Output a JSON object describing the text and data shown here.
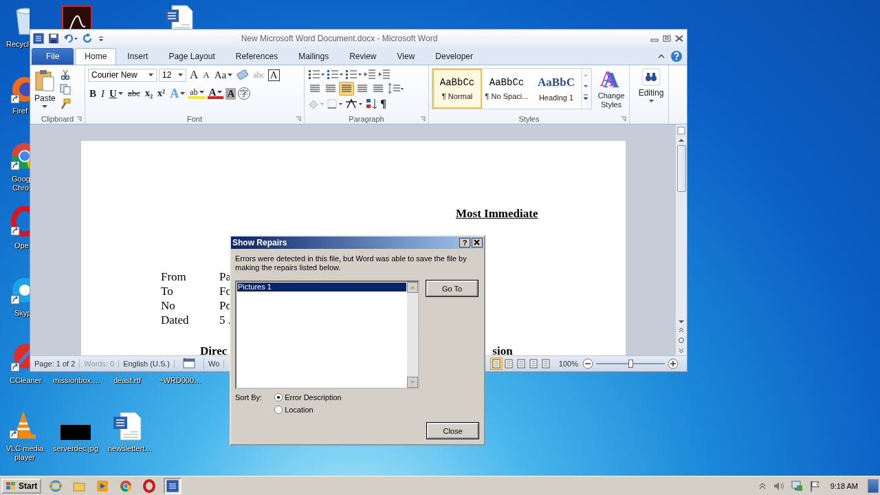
{
  "desktop": {
    "icons": [
      {
        "label": "Recycl",
        "kind": "recycle",
        "shortcut": false
      },
      {
        "kind": "pdf",
        "shortcut": false
      },
      {
        "kind": "doc",
        "shortcut": false
      },
      {
        "label": "Firef",
        "kind": "firefox",
        "shortcut": true
      },
      {
        "label": "Goog Chro",
        "kind": "chrome",
        "shortcut": true
      },
      {
        "label": "Ope",
        "kind": "opera",
        "shortcut": true
      },
      {
        "label": "Skyp",
        "kind": "skype",
        "shortcut": true
      },
      {
        "label": "CCleaner",
        "kind": "ccleaner",
        "shortcut": true
      },
      {
        "label": "missionbox.…",
        "kind": "hidden"
      },
      {
        "label": "deast.rtf",
        "kind": "hidden"
      },
      {
        "label": "~WRD000…",
        "kind": "hidden"
      },
      {
        "label": "VLC media player",
        "kind": "vlc",
        "shortcut": true
      },
      {
        "label": "serverdec.jpg",
        "kind": "image",
        "shortcut": false
      },
      {
        "label": "newslettert…",
        "kind": "doc",
        "shortcut": false
      }
    ]
  },
  "word": {
    "title": "New Microsoft Word Document.docx - Microsoft Word",
    "tabs": [
      {
        "label": "File",
        "selected": false,
        "kind": "file"
      },
      {
        "label": "Home",
        "selected": true,
        "kind": "tab"
      },
      {
        "label": "Insert",
        "selected": false,
        "kind": "tab"
      },
      {
        "label": "Page Layout",
        "selected": false,
        "kind": "tab"
      },
      {
        "label": "References",
        "selected": false,
        "kind": "tab"
      },
      {
        "label": "Mailings",
        "selected": false,
        "kind": "tab"
      },
      {
        "label": "Review",
        "selected": false,
        "kind": "tab"
      },
      {
        "label": "View",
        "selected": false,
        "kind": "tab"
      },
      {
        "label": "Developer",
        "selected": false,
        "kind": "tab"
      }
    ],
    "clipboard": {
      "paste": "Paste",
      "group": "Clipboard"
    },
    "font": {
      "face": "Courier New",
      "size": "12",
      "group": "Font",
      "row1": [
        {
          "kind": "grow",
          "text": "A"
        },
        {
          "kind": "shrink",
          "text": "A"
        },
        {
          "kind": "case",
          "text": "Aa"
        },
        {
          "kind": "clear"
        },
        {
          "kind": "phonetic",
          "text": "abc"
        },
        {
          "kind": "border",
          "text": "A"
        }
      ],
      "row2": [
        {
          "kind": "bold",
          "text": "B"
        },
        {
          "kind": "italic",
          "text": "I"
        },
        {
          "kind": "underline",
          "text": "U"
        },
        {
          "kind": "strike",
          "text": "abc"
        },
        {
          "kind": "sub",
          "text": "x₂"
        },
        {
          "kind": "sup",
          "text": "x²"
        },
        {
          "kind": "effects",
          "text": "A"
        },
        {
          "kind": "highlight",
          "text": "ab"
        },
        {
          "kind": "color",
          "text": "A"
        },
        {
          "kind": "shading",
          "text": "A"
        },
        {
          "kind": "enclose",
          "text": "字"
        }
      ]
    },
    "paragraph": {
      "group": "Paragraph",
      "pilcrow": "¶",
      "alignment": [
        {
          "selected": false
        },
        {
          "selected": false
        },
        {
          "selected": true
        },
        {
          "selected": false
        },
        {
          "selected": false
        }
      ]
    },
    "styles": {
      "group": "Styles",
      "items": [
        {
          "preview": "AaBbCc",
          "name": "¶ Normal",
          "selected": true,
          "kind": "plain"
        },
        {
          "preview": "AaBbCc",
          "name": "¶ No Spaci...",
          "selected": false,
          "kind": "plain"
        },
        {
          "preview": "AaBbC",
          "name": "Heading 1",
          "selected": false,
          "kind": "heading"
        }
      ],
      "change_glyph": "A",
      "change_label": "Change Styles"
    },
    "editing": {
      "label": "Editing"
    },
    "document": {
      "heading": "Most Immediate",
      "fields": [
        {
          "label": "From",
          "value": "Pa"
        },
        {
          "label": "To",
          "value": "Fo"
        },
        {
          "label": "No",
          "value": "Po"
        },
        {
          "label": "Dated",
          "value": "5 ."
        }
      ],
      "subject_left": "Direc",
      "subject_right": "sion"
    },
    "status": {
      "page": "Page: 1 of 2",
      "words": "Words: 0",
      "language": "English (U.S.)",
      "mode": "Wo",
      "views": [
        {
          "selected": true
        },
        {
          "selected": false
        },
        {
          "selected": false
        },
        {
          "selected": false
        },
        {
          "selected": false
        }
      ],
      "zoom": "100%",
      "zoom_slider": {
        "level": 0.5
      }
    }
  },
  "dialog": {
    "title": "Show Repairs",
    "help": "?",
    "message": "Errors were detected in this file, but Word was able to save the file by making the repairs listed below.",
    "repairs": [
      {
        "label": "Pictures 1",
        "selected": true
      }
    ],
    "go_to": "Go To",
    "sort_label": "Sort By:",
    "sort_options": [
      {
        "label": "Error Description",
        "selected": true
      },
      {
        "label": "Location",
        "selected": false
      }
    ],
    "close": "Close"
  },
  "taskbar": {
    "start": "Start",
    "apps": [
      {
        "kind": "ie",
        "selected": false
      },
      {
        "kind": "folder",
        "selected": false
      },
      {
        "kind": "media",
        "selected": false
      },
      {
        "kind": "chrome",
        "selected": false
      },
      {
        "kind": "opera",
        "selected": false
      },
      {
        "kind": "word",
        "selected": true
      }
    ],
    "clock": "9:18 AM"
  }
}
